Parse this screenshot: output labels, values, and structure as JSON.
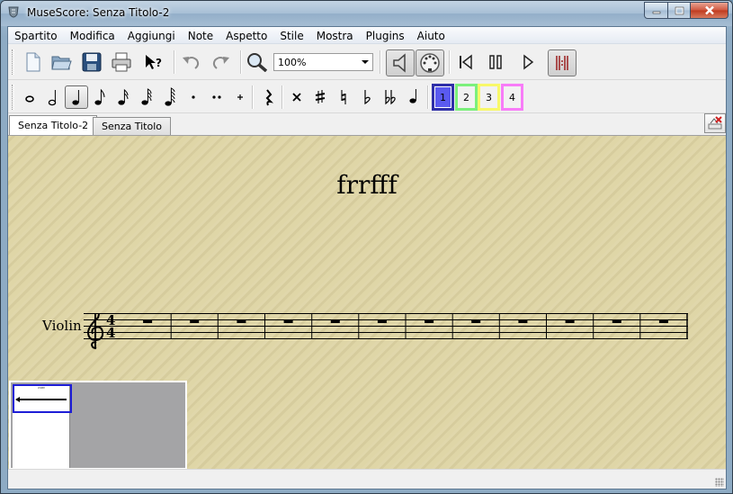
{
  "window": {
    "title": "MuseScore: Senza Titolo-2"
  },
  "menu": [
    "Spartito",
    "Modifica",
    "Aggiungi",
    "Note",
    "Aspetto",
    "Stile",
    "Mostra",
    "Plugins",
    "Aiuto"
  ],
  "toolbar": {
    "zoom": "100%"
  },
  "voices": [
    "1",
    "2",
    "3",
    "4"
  ],
  "tabs": [
    "Senza Titolo-2",
    "Senza Titolo"
  ],
  "score": {
    "title": "frrfff",
    "instrument": "Violin",
    "time_signature_top": "4",
    "time_signature_bottom": "4",
    "measure_count": 12
  },
  "navigator": {
    "thumb_title": "frrfff"
  },
  "colors": {
    "voice1": "#5a5af0",
    "voice2": "#7cf07c",
    "voice3": "#f8f86a",
    "voice4": "#f87cf8",
    "paper": "#ddd3a2"
  }
}
